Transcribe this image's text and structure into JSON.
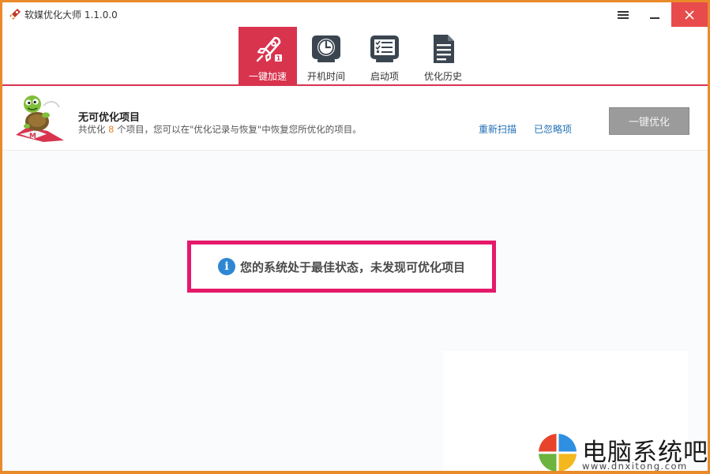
{
  "window": {
    "title": "软媒优化大师 1.1.0.0",
    "accent_color": "#d8344e",
    "close_color": "#e84b4b"
  },
  "toolbar": {
    "tabs": [
      {
        "label": "一键加速",
        "icon": "rocket-icon",
        "active": true,
        "badge": "1"
      },
      {
        "label": "开机时间",
        "icon": "clock-icon",
        "active": false
      },
      {
        "label": "启动项",
        "icon": "checklist-icon",
        "active": false
      },
      {
        "label": "优化历史",
        "icon": "document-icon",
        "active": false
      }
    ]
  },
  "status": {
    "title": "无可优化项目",
    "desc_prefix": "共优化 ",
    "count": "8",
    "desc_suffix": " 个项目，您可以在\"优化记录与恢复\"中恢复您所优化的项目。",
    "rescan_label": "重新扫描",
    "ignored_label": "已忽略项",
    "optimize_label": "一键优化"
  },
  "message": {
    "text": "您的系统处于最佳状态，未发现可优化项目",
    "border_color": "#e5196a"
  },
  "watermark": {
    "title": "电脑系统吧",
    "url": "www.dnxitong.com"
  }
}
